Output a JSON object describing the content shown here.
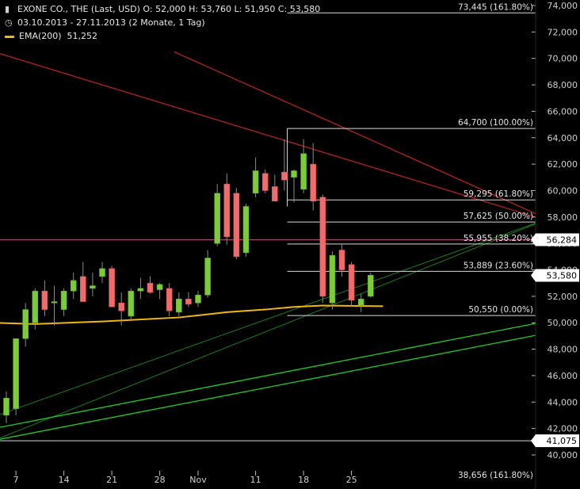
{
  "header": {
    "title_line": "EXONE CO., THE (Last, USD)  O: 52,000  H: 53,760  L: 51,950  C: 53,580",
    "range_line": "03.10.2013 - 27.11.2013 (2 Monate, 1 Tag)",
    "indicator_label": "EMA(200)",
    "indicator_value": "51,252",
    "chart_icon": "candlestick-icon",
    "clock_icon": "clock-icon"
  },
  "colors": {
    "background": "#000000",
    "up_candle": "#7ccc3a",
    "down_candle": "#f06b6b",
    "ema": "#f2b70d",
    "fib_line": "#d9d9d9",
    "resistance_line": "#b22222",
    "support_line": "#22cc22",
    "magenta_line": "#b0457a"
  },
  "chart_data": {
    "type": "candlestick",
    "y_ticks": [
      "40,000",
      "42,000",
      "44,000",
      "46,000",
      "48,000",
      "50,000",
      "52,000",
      "54,000",
      "56,000",
      "58,000",
      "60,000",
      "62,000",
      "64,000",
      "66,000",
      "68,000",
      "70,000",
      "72,000",
      "74,000"
    ],
    "ylim": [
      39500,
      74200
    ],
    "x_ticks": [
      {
        "label": "7",
        "index": 1
      },
      {
        "label": "14",
        "index": 6
      },
      {
        "label": "21",
        "index": 11
      },
      {
        "label": "28",
        "index": 16
      },
      {
        "label": "Nov",
        "index": 20
      },
      {
        "label": "11",
        "index": 26
      },
      {
        "label": "18",
        "index": 31
      },
      {
        "label": "25",
        "index": 36
      }
    ],
    "candles": [
      {
        "o": 43.0,
        "h": 44.8,
        "l": 42.4,
        "c": 44.3
      },
      {
        "o": 43.5,
        "h": 46.5,
        "l": 43.0,
        "c": 48.8
      },
      {
        "o": 48.8,
        "h": 51.5,
        "l": 48.2,
        "c": 51.0
      },
      {
        "o": 50.0,
        "h": 52.6,
        "l": 49.5,
        "c": 52.4
      },
      {
        "o": 52.4,
        "h": 53.2,
        "l": 50.5,
        "c": 51.0
      },
      {
        "o": 51.5,
        "h": 52.8,
        "l": 49.8,
        "c": 51.6
      },
      {
        "o": 51.0,
        "h": 52.6,
        "l": 50.5,
        "c": 52.4
      },
      {
        "o": 52.4,
        "h": 53.8,
        "l": 51.8,
        "c": 53.2
      },
      {
        "o": 53.5,
        "h": 54.6,
        "l": 51.6,
        "c": 51.6
      },
      {
        "o": 52.6,
        "h": 53.8,
        "l": 52.0,
        "c": 52.8
      },
      {
        "o": 53.5,
        "h": 54.6,
        "l": 53.0,
        "c": 54.1
      },
      {
        "o": 54.1,
        "h": 54.3,
        "l": 51.2,
        "c": 51.2
      },
      {
        "o": 51.5,
        "h": 52.3,
        "l": 49.8,
        "c": 50.9
      },
      {
        "o": 50.5,
        "h": 52.6,
        "l": 50.2,
        "c": 52.4
      },
      {
        "o": 52.4,
        "h": 53.4,
        "l": 51.8,
        "c": 52.6
      },
      {
        "o": 53.0,
        "h": 53.5,
        "l": 52.2,
        "c": 52.3
      },
      {
        "o": 52.5,
        "h": 53.0,
        "l": 51.8,
        "c": 52.9
      },
      {
        "o": 52.6,
        "h": 53.0,
        "l": 50.5,
        "c": 50.9
      },
      {
        "o": 50.8,
        "h": 52.3,
        "l": 50.5,
        "c": 51.8
      },
      {
        "o": 51.8,
        "h": 52.3,
        "l": 51.2,
        "c": 51.4
      },
      {
        "o": 51.5,
        "h": 52.4,
        "l": 51.2,
        "c": 52.1
      },
      {
        "o": 52.1,
        "h": 55.5,
        "l": 51.9,
        "c": 54.9
      },
      {
        "o": 56.0,
        "h": 60.5,
        "l": 55.8,
        "c": 59.8
      },
      {
        "o": 60.5,
        "h": 61.3,
        "l": 55.9,
        "c": 56.5
      },
      {
        "o": 59.8,
        "h": 60.2,
        "l": 54.8,
        "c": 55.0
      },
      {
        "o": 55.3,
        "h": 59.0,
        "l": 55.0,
        "c": 58.8
      },
      {
        "o": 59.8,
        "h": 62.5,
        "l": 59.5,
        "c": 61.5
      },
      {
        "o": 61.3,
        "h": 61.6,
        "l": 59.8,
        "c": 60.0
      },
      {
        "o": 60.3,
        "h": 61.2,
        "l": 59.5,
        "c": 59.2
      },
      {
        "o": 61.4,
        "h": 63.9,
        "l": 60.0,
        "c": 60.8
      },
      {
        "o": 61.0,
        "h": 61.6,
        "l": 59.1,
        "c": 61.5
      },
      {
        "o": 60.1,
        "h": 63.9,
        "l": 59.8,
        "c": 62.8
      },
      {
        "o": 62.0,
        "h": 63.6,
        "l": 58.5,
        "c": 59.2
      },
      {
        "o": 59.5,
        "h": 59.7,
        "l": 51.5,
        "c": 52.0
      },
      {
        "o": 51.5,
        "h": 55.4,
        "l": 51.0,
        "c": 55.1
      },
      {
        "o": 55.5,
        "h": 56.0,
        "l": 53.5,
        "c": 54.0
      },
      {
        "o": 54.4,
        "h": 54.6,
        "l": 51.2,
        "c": 51.7
      },
      {
        "o": 51.3,
        "h": 52.2,
        "l": 50.8,
        "c": 51.8
      },
      {
        "o": 52.0,
        "h": 53.8,
        "l": 51.9,
        "c": 53.6
      }
    ],
    "ema200": [
      {
        "i": -1.3,
        "v": 50.0
      },
      {
        "i": 3,
        "v": 49.9
      },
      {
        "i": 10,
        "v": 50.1
      },
      {
        "i": 18,
        "v": 50.4
      },
      {
        "i": 23,
        "v": 50.8
      },
      {
        "i": 27,
        "v": 51.0
      },
      {
        "i": 30,
        "v": 51.2
      },
      {
        "i": 33,
        "v": 51.3
      },
      {
        "i": 39.3,
        "v": 51.25
      }
    ],
    "fibonacci": [
      {
        "value": 73.445,
        "label": "73,445 (161.80%)"
      },
      {
        "value": 64.7,
        "label": "64,700 (100.00%)"
      },
      {
        "value": 59.295,
        "label": "59,295 (61.80%)"
      },
      {
        "value": 57.625,
        "label": "57,625 (50.00%)"
      },
      {
        "value": 55.955,
        "label": "55,955 (38.20%)"
      },
      {
        "value": 53.889,
        "label": "53,889 (23.60%)"
      },
      {
        "value": 50.55,
        "label": "50,550 (0.00%)"
      },
      {
        "value": 38.656,
        "label": "38,656 (161.80%)"
      }
    ],
    "price_tags": [
      {
        "value": 56.284,
        "label": "56,284"
      },
      {
        "value": 53.58,
        "label": "53,580"
      },
      {
        "value": 41.075,
        "label": "41,075"
      }
    ],
    "horizontal_levels": [
      56.284,
      41.075
    ],
    "trendlines": [
      {
        "kind": "resistance",
        "from": [
          -1.3,
          70.5
        ],
        "to": [
          57,
          57.6
        ]
      },
      {
        "kind": "resistance",
        "from": [
          17.5,
          70.5
        ],
        "to": [
          56,
          58.0
        ]
      },
      {
        "kind": "support",
        "from": [
          -1.3,
          42.0
        ],
        "to": [
          57,
          50.2
        ]
      },
      {
        "kind": "support",
        "from": [
          -1.3,
          41.1
        ],
        "to": [
          57,
          49.3
        ]
      },
      {
        "kind": "support_thin",
        "from": [
          -1.3,
          42.9
        ],
        "to": [
          57,
          58.0
        ]
      },
      {
        "kind": "support_thin",
        "from": [
          -1.3,
          41.1
        ],
        "to": [
          57,
          58.0
        ]
      }
    ]
  }
}
